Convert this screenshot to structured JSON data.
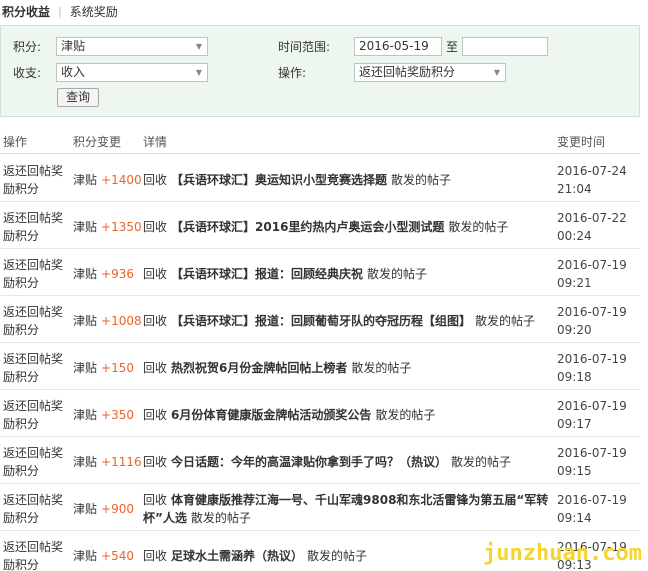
{
  "tabs": [
    {
      "label": "积分收益"
    },
    {
      "label": "系统奖励"
    }
  ],
  "filter": {
    "points_label": "积分:",
    "points_value": "津贴",
    "income_label": "收支:",
    "income_value": "收入",
    "time_label": "时间范围:",
    "time_from": "2016-05-19",
    "time_sep": "至",
    "time_to": "",
    "action_label": "操作:",
    "action_value": "返还回帖奖励积分",
    "query_button": "查询"
  },
  "table": {
    "headers": [
      "操作",
      "积分变更",
      "详情",
      "变更时间"
    ],
    "rows": [
      {
        "op": "返还回帖奖励积分",
        "type": "津贴",
        "amount": "+1400",
        "pre": "回收",
        "title": "【兵语环球汇】奥运知识小型竞赛选择题",
        "suffix": "散发的帖子",
        "date": "2016-07-24",
        "time": "21:04"
      },
      {
        "op": "返还回帖奖励积分",
        "type": "津贴",
        "amount": "+1350",
        "pre": "回收",
        "title": "【兵语环球汇】2016里约热内卢奥运会小型测试题",
        "suffix": "散发的帖子",
        "date": "2016-07-22",
        "time": "00:24"
      },
      {
        "op": "返还回帖奖励积分",
        "type": "津贴",
        "amount": "+936",
        "pre": "回收",
        "title": "【兵语环球汇】报道：回顾经典庆祝",
        "suffix": "散发的帖子",
        "date": "2016-07-19",
        "time": "09:21"
      },
      {
        "op": "返还回帖奖励积分",
        "type": "津贴",
        "amount": "+1008",
        "pre": "回收",
        "title": "【兵语环球汇】报道：回顾葡萄牙队的夺冠历程【组图】",
        "suffix": "散发的帖子",
        "date": "2016-07-19",
        "time": "09:20"
      },
      {
        "op": "返还回帖奖励积分",
        "type": "津贴",
        "amount": "+150",
        "pre": "回收",
        "title": "热烈祝贺6月份金牌帖回帖上榜者",
        "suffix": "散发的帖子",
        "date": "2016-07-19",
        "time": "09:18"
      },
      {
        "op": "返还回帖奖励积分",
        "type": "津贴",
        "amount": "+350",
        "pre": "回收",
        "title": "6月份体育健康版金牌帖活动颁奖公告",
        "suffix": "散发的帖子",
        "date": "2016-07-19",
        "time": "09:17"
      },
      {
        "op": "返还回帖奖励积分",
        "type": "津贴",
        "amount": "+1116",
        "pre": "回收",
        "title": "今日话题：今年的高温津贴你拿到手了吗？（热议）",
        "suffix": "散发的帖子",
        "date": "2016-07-19",
        "time": "09:15"
      },
      {
        "op": "返还回帖奖励积分",
        "type": "津贴",
        "amount": "+900",
        "pre": "回收",
        "title": "体育健康版推荐江海一号、千山军魂9808和东北活雷锋为第五届“军转杯”人选",
        "suffix": "散发的帖子",
        "date": "2016-07-19",
        "time": "09:14"
      },
      {
        "op": "返还回帖奖励积分",
        "type": "津贴",
        "amount": "+540",
        "pre": "回收",
        "title": "足球水土需涵养（热议）",
        "suffix": "散发的帖子",
        "date": "2016-07-19",
        "time": "09:13"
      }
    ]
  },
  "watermark": "junzhuan.com",
  "colors": {
    "amount": "#e9642a",
    "filter_bg": "#eef6f0",
    "watermark": "#f6d531"
  }
}
